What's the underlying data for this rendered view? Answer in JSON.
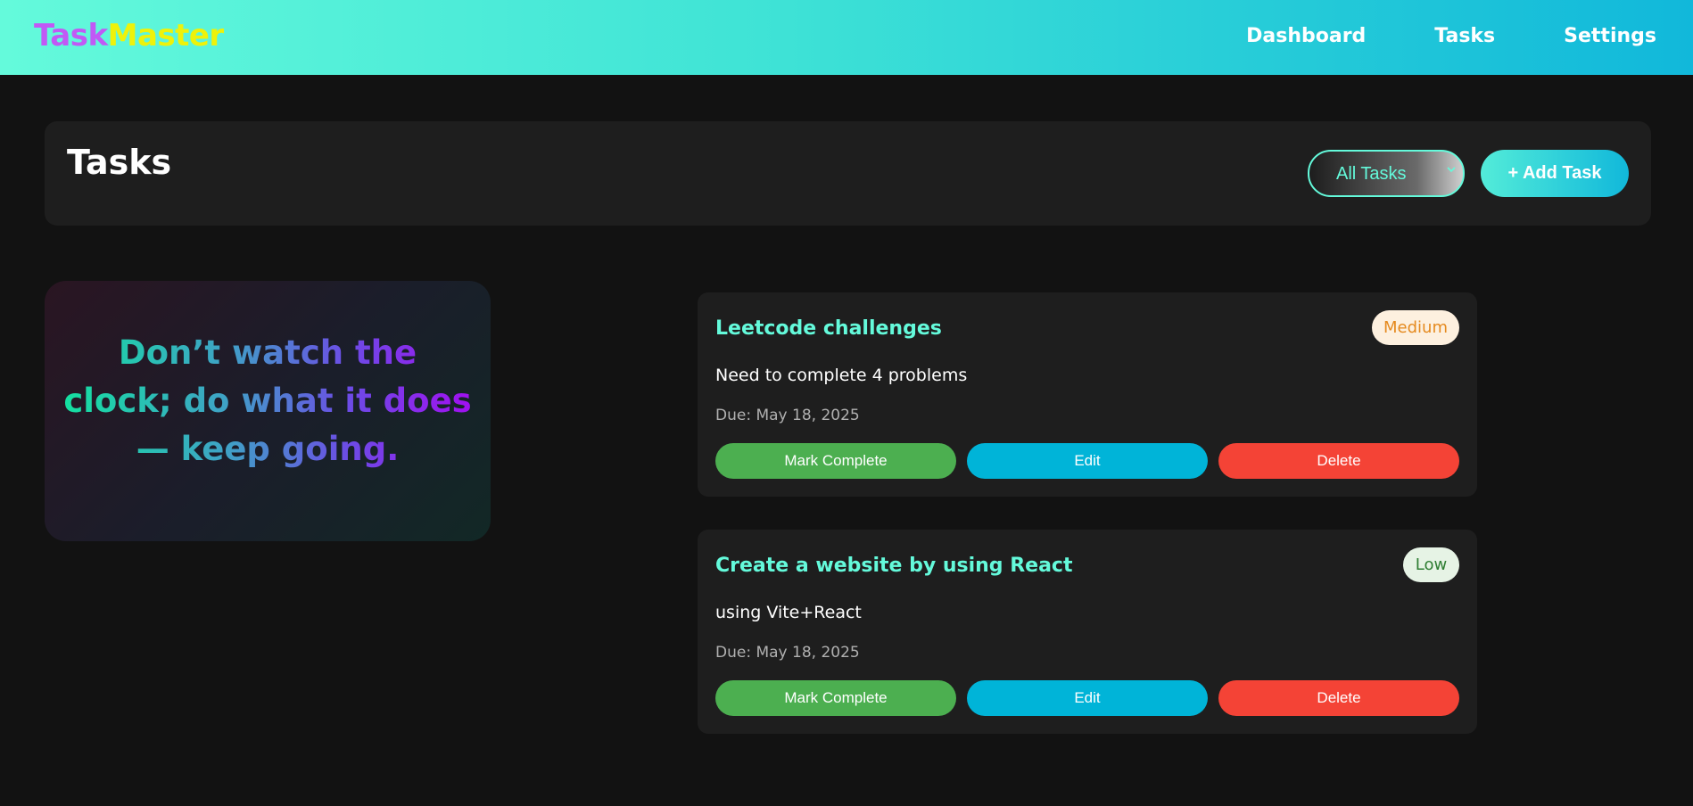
{
  "navbar": {
    "brand_part1": "Task",
    "brand_part2": "Master",
    "links": [
      "Dashboard",
      "Tasks",
      "Settings"
    ]
  },
  "header": {
    "title": "Tasks",
    "filter_value": "All Tasks",
    "add_button_label": "+ Add Task"
  },
  "quote": {
    "text": "Don’t watch the clock; do what it does — keep going."
  },
  "tasks": [
    {
      "title": "Leetcode challenges",
      "priority": "Medium",
      "description": "Need to complete 4 problems",
      "due": "Due: May 18, 2025",
      "complete_label": "Mark Complete",
      "edit_label": "Edit",
      "delete_label": "Delete"
    },
    {
      "title": "Create a website by using React",
      "priority": "Low",
      "description": "using Vite+React",
      "due": "Due: May 18, 2025",
      "complete_label": "Mark Complete",
      "edit_label": "Edit",
      "delete_label": "Delete"
    }
  ],
  "colors": {
    "accent": "#64fadb",
    "background": "#121212",
    "card": "#1e1e1e",
    "complete": "#4caf50",
    "edit": "#00b4d8",
    "delete": "#f44336"
  }
}
